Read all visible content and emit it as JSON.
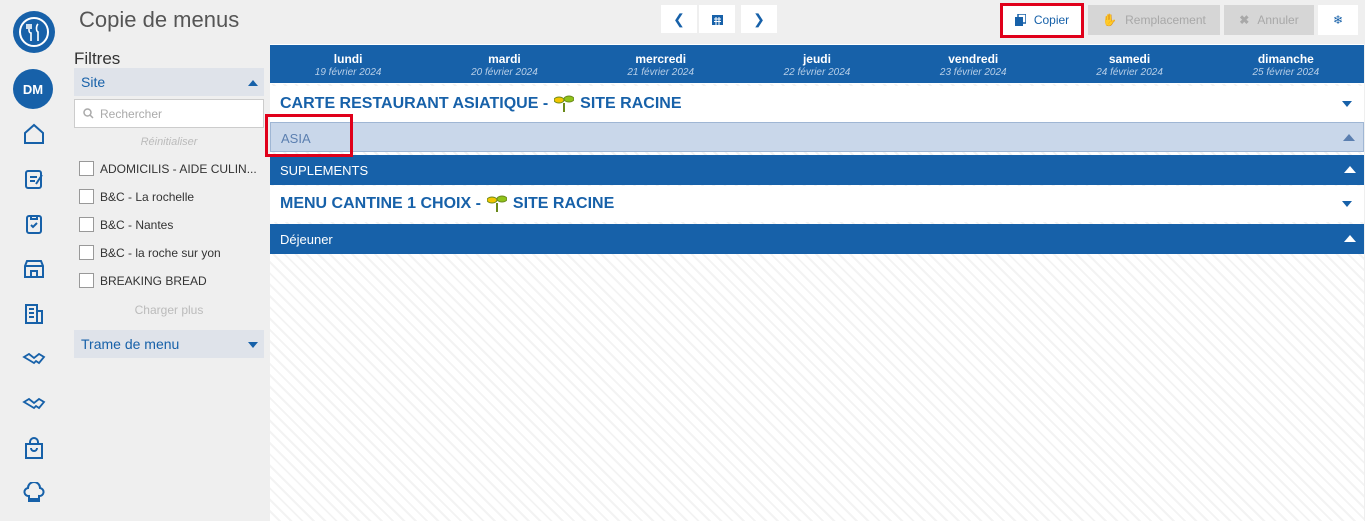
{
  "avatar": "DM",
  "title": "Copie de menus",
  "toolbar": {
    "copier": "Copier",
    "remplacement": "Remplacement",
    "annuler": "Annuler"
  },
  "filters": {
    "heading": "Filtres",
    "site": "Site",
    "search_placeholder": "Rechercher",
    "reset": "Réinitialiser",
    "sites": [
      "ADOMICILIS - AIDE CULIN...",
      "B&C - La rochelle",
      "B&C - Nantes",
      "B&C - la roche sur yon",
      "BREAKING BREAD"
    ],
    "load_more": "Charger plus",
    "trame": "Trame de menu"
  },
  "days": [
    {
      "name": "lundi",
      "date": "19 février 2024"
    },
    {
      "name": "mardi",
      "date": "20 février 2024"
    },
    {
      "name": "mercredi",
      "date": "21 février 2024"
    },
    {
      "name": "jeudi",
      "date": "22 février 2024"
    },
    {
      "name": "vendredi",
      "date": "23 février 2024"
    },
    {
      "name": "samedi",
      "date": "24 février 2024"
    },
    {
      "name": "dimanche",
      "date": "25 février 2024"
    }
  ],
  "menus": [
    {
      "title": "CARTE RESTAURANT ASIATIQUE -",
      "site": "SITE RACINE",
      "sections": [
        "ASIA",
        "SUPLEMENTS"
      ]
    },
    {
      "title": "MENU CANTINE 1 CHOIX -",
      "site": "SITE RACINE",
      "sections": [
        "Déjeuner"
      ]
    }
  ],
  "colors": {
    "primary": "#1761a9",
    "highlight": "#e0001a"
  }
}
